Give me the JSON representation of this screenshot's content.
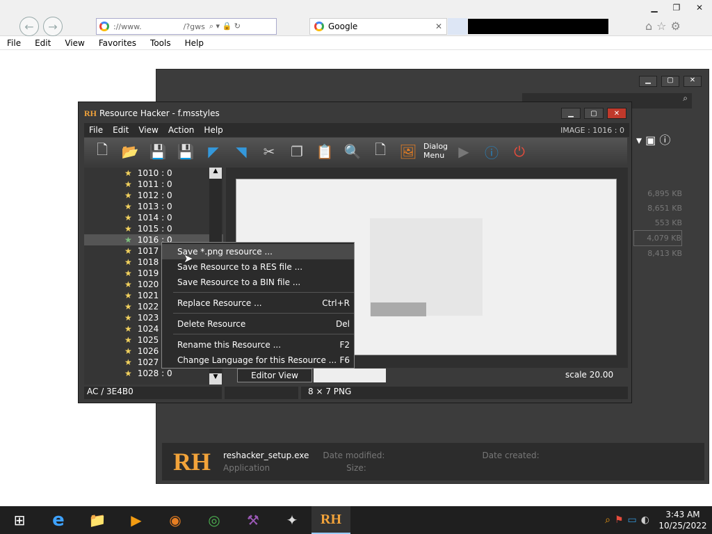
{
  "browser": {
    "address": "://www.",
    "address_suffix": "/?gws",
    "tab_title": "Google",
    "menu": [
      "File",
      "Edit",
      "View",
      "Favorites",
      "Tools",
      "Help"
    ]
  },
  "rh": {
    "title": "Resource Hacker - f.msstyles",
    "logo": "RH",
    "menu": [
      "File",
      "Edit",
      "View",
      "Action",
      "Help"
    ],
    "image_label": "IMAGE : 1016 : 0",
    "dialog_label_1": "Dialog",
    "dialog_label_2": "Menu",
    "tree": [
      "1010 : 0",
      "1011 : 0",
      "1012 : 0",
      "1013 : 0",
      "1014 : 0",
      "1015 : 0",
      "1016 : 0",
      "1017",
      "1018",
      "1019",
      "1020",
      "1021",
      "1022",
      "1023",
      "1024",
      "1025",
      "1026",
      "1027",
      "1028 : 0"
    ],
    "editor_view": "Editor View",
    "scale": "scale 20.00",
    "status_left": "AC / 3E4B0",
    "status_right": "8 × 7  PNG"
  },
  "context_menu": {
    "items": [
      {
        "label": "Save *.png resource ...",
        "shortcut": ""
      },
      {
        "label": "Save Resource to a RES file ...",
        "shortcut": ""
      },
      {
        "label": "Save Resource to a BIN file ...",
        "shortcut": ""
      },
      {
        "label": "Replace Resource ...",
        "shortcut": "Ctrl+R"
      },
      {
        "label": "Delete Resource",
        "shortcut": "Del"
      },
      {
        "label": "Rename this Resource ...",
        "shortcut": "F2"
      },
      {
        "label": "Change Language for this Resource ...",
        "shortcut": "F6"
      }
    ]
  },
  "explorer": {
    "sizes": [
      "6,895 KB",
      "8,651 KB",
      "553 KB",
      "4,079 KB",
      "8,413 KB"
    ],
    "file_name": "reshacker_setup.exe",
    "date_modified_label": "Date modified:",
    "date_created_label": "Date created:",
    "type": "Application",
    "size_label": "Size:"
  },
  "clock": {
    "time": "3:43 AM",
    "date": "10/25/2022"
  }
}
